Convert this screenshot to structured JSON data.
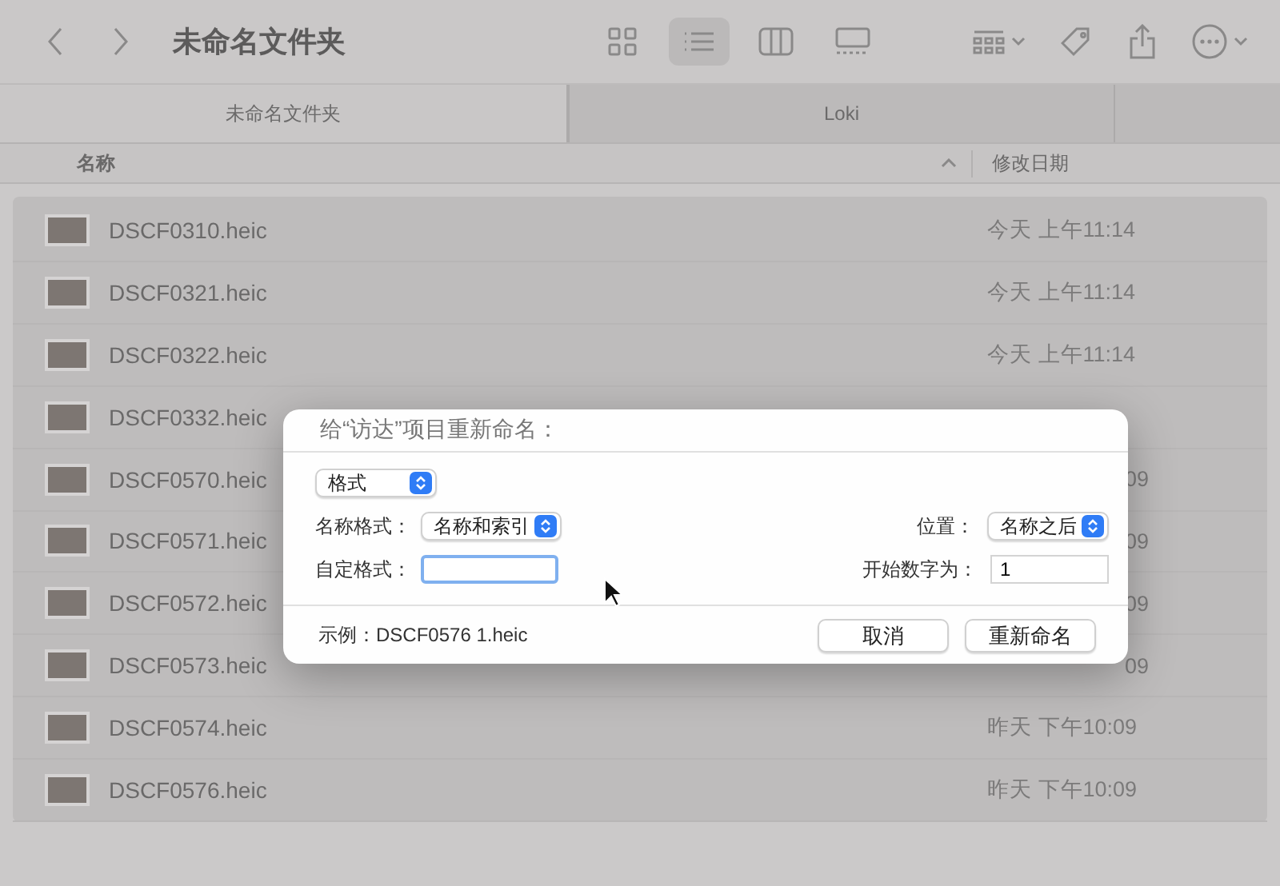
{
  "window": {
    "title": "未命名文件夹"
  },
  "view_buttons": [
    {
      "kind": "icons",
      "selected": false
    },
    {
      "kind": "list",
      "selected": true
    },
    {
      "kind": "columns",
      "selected": false
    },
    {
      "kind": "gallery",
      "selected": false
    }
  ],
  "tabs": [
    {
      "label": "未命名文件夹",
      "selected": true
    },
    {
      "label": "Loki",
      "selected": false
    }
  ],
  "columns": [
    "名称",
    "修改日期"
  ],
  "files": [
    {
      "name": "DSCF0310.heic",
      "date": "今天 上午11:14",
      "kind": "full"
    },
    {
      "name": "DSCF0321.heic",
      "date": "今天 上午11:14",
      "kind": "full"
    },
    {
      "name": "DSCF0322.heic",
      "date": "今天 上午11:14",
      "kind": "full"
    },
    {
      "name": "DSCF0332.heic"
    },
    {
      "name": "DSCF0570.heic",
      "date": "09",
      "kind": "partial"
    },
    {
      "name": "DSCF0571.heic",
      "date": "09",
      "kind": "partial"
    },
    {
      "name": "DSCF0572.heic",
      "date": "09",
      "kind": "partial"
    },
    {
      "name": "DSCF0573.heic",
      "date": "09",
      "kind": "partial"
    },
    {
      "name": "DSCF0574.heic",
      "date": "昨天 下午10:09",
      "kind": "full"
    },
    {
      "name": "DSCF0576.heic",
      "date": "昨天 下午10:09",
      "kind": "full"
    }
  ],
  "dialog": {
    "title": "给“访达”项目重新命名：",
    "mode": "格式",
    "name_format_label": "名称格式：",
    "name_format": "名称和索引",
    "position_label": "位置：",
    "position": "名称之后",
    "custom_format_label": "自定格式：",
    "start_label": "开始数字为：",
    "start_value": "1",
    "example": "示例：DSCF0576 1.heic",
    "buttons": [
      "取消",
      "重新命名"
    ]
  }
}
